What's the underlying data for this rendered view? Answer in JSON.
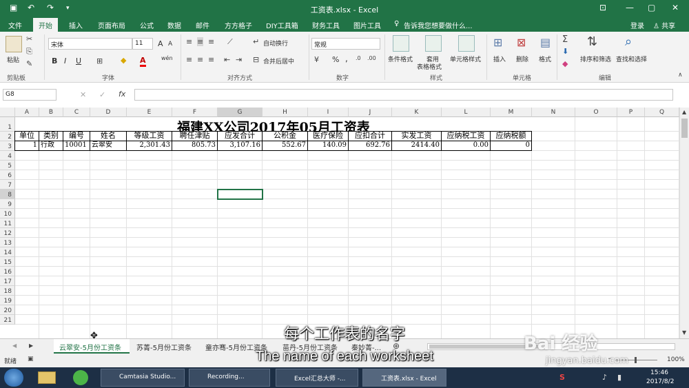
{
  "window": {
    "title": "工资表.xlsx - Excel"
  },
  "quick_access": {
    "save_icon": "save-icon",
    "undo_icon": "undo-icon",
    "redo_icon": "redo-icon"
  },
  "window_controls": {
    "minimize": "—",
    "maximize": "▢",
    "close": "✕",
    "options": "⊡"
  },
  "ribbon_tabs": [
    "文件",
    "开始",
    "插入",
    "页面布局",
    "公式",
    "数据",
    "邮件",
    "方方格子",
    "DIY工具箱",
    "财务工具",
    "图片工具"
  ],
  "active_tab": "开始",
  "tell_me": "告诉我您想要做什么...",
  "login": "登录",
  "share": "共享",
  "ribbon": {
    "clipboard": {
      "paste": "粘贴",
      "group": "剪贴板"
    },
    "font": {
      "name": "宋体",
      "size": "11",
      "group": "字体",
      "bold": "B",
      "italic": "I",
      "underline": "U",
      "grow": "A",
      "shrink": "A",
      "wen": "wén"
    },
    "align": {
      "wrap": "自动换行",
      "merge": "合并后居中",
      "group": "对齐方式"
    },
    "number": {
      "format": "常规",
      "group": "数字",
      "percent": "%",
      "comma": ","
    },
    "styles": {
      "conditional": "条件格式",
      "table": "套用\n表格格式",
      "table1": "套用",
      "table2": "表格格式",
      "cell_style": "单元格样式",
      "group": "样式"
    },
    "cells": {
      "insert": "插入",
      "delete": "删除",
      "format": "格式",
      "group": "单元格"
    },
    "edit": {
      "sort": "排序和筛选",
      "find": "查找和选择",
      "group": "编辑"
    }
  },
  "formula_bar": {
    "name_box": "G8",
    "cancel": "✕",
    "enter": "✓",
    "fx": "fx",
    "formula": ""
  },
  "columns": [
    "A",
    "B",
    "C",
    "D",
    "E",
    "F",
    "G",
    "H",
    "I",
    "J",
    "K",
    "L",
    "M",
    "N",
    "O",
    "P",
    "Q"
  ],
  "rows": [
    "1",
    "2",
    "3",
    "4",
    "5",
    "6",
    "7",
    "8",
    "9",
    "10",
    "11",
    "12",
    "13",
    "14",
    "15",
    "16",
    "17",
    "18",
    "19",
    "20",
    "21"
  ],
  "sheet": {
    "title": "福建XX公司2017年05月工资表",
    "headers": [
      "单位",
      "类别",
      "编号",
      "姓名",
      "等级工资",
      "聘任津贴",
      "应发合计",
      "公积金",
      "医疗保险",
      "应扣合计",
      "实发工资",
      "应纳税工资",
      "应纳税额"
    ],
    "row3": [
      "1",
      "行政",
      "10001",
      "云翠安",
      "2,301.43",
      "805.73",
      "3,107.16",
      "552.67",
      "140.09",
      "692.76",
      "2414.40",
      "0.00",
      "0"
    ]
  },
  "sheet_tabs": [
    "云翠安-5月份工资条",
    "苏菁-5月份工资条",
    "童亦骞-5月份工资条",
    "苗丹-5月份工资条",
    "秦妙菁-..."
  ],
  "add_sheet": "⊕",
  "status": {
    "ready": "就绪",
    "zoom": "100%"
  },
  "subtitles": {
    "cn": "每个工作表的名字",
    "en": "The name of each worksheet"
  },
  "watermark": {
    "brand": "Bai 经验",
    "url": "jingyan.baidu.com"
  },
  "taskbar": {
    "items": [
      "Camtasia Studio...",
      "Recording...",
      "Excel汇总大师 -...",
      "工资表.xlsx - Excel"
    ],
    "time": "15:46",
    "date": "2017/8/2"
  }
}
